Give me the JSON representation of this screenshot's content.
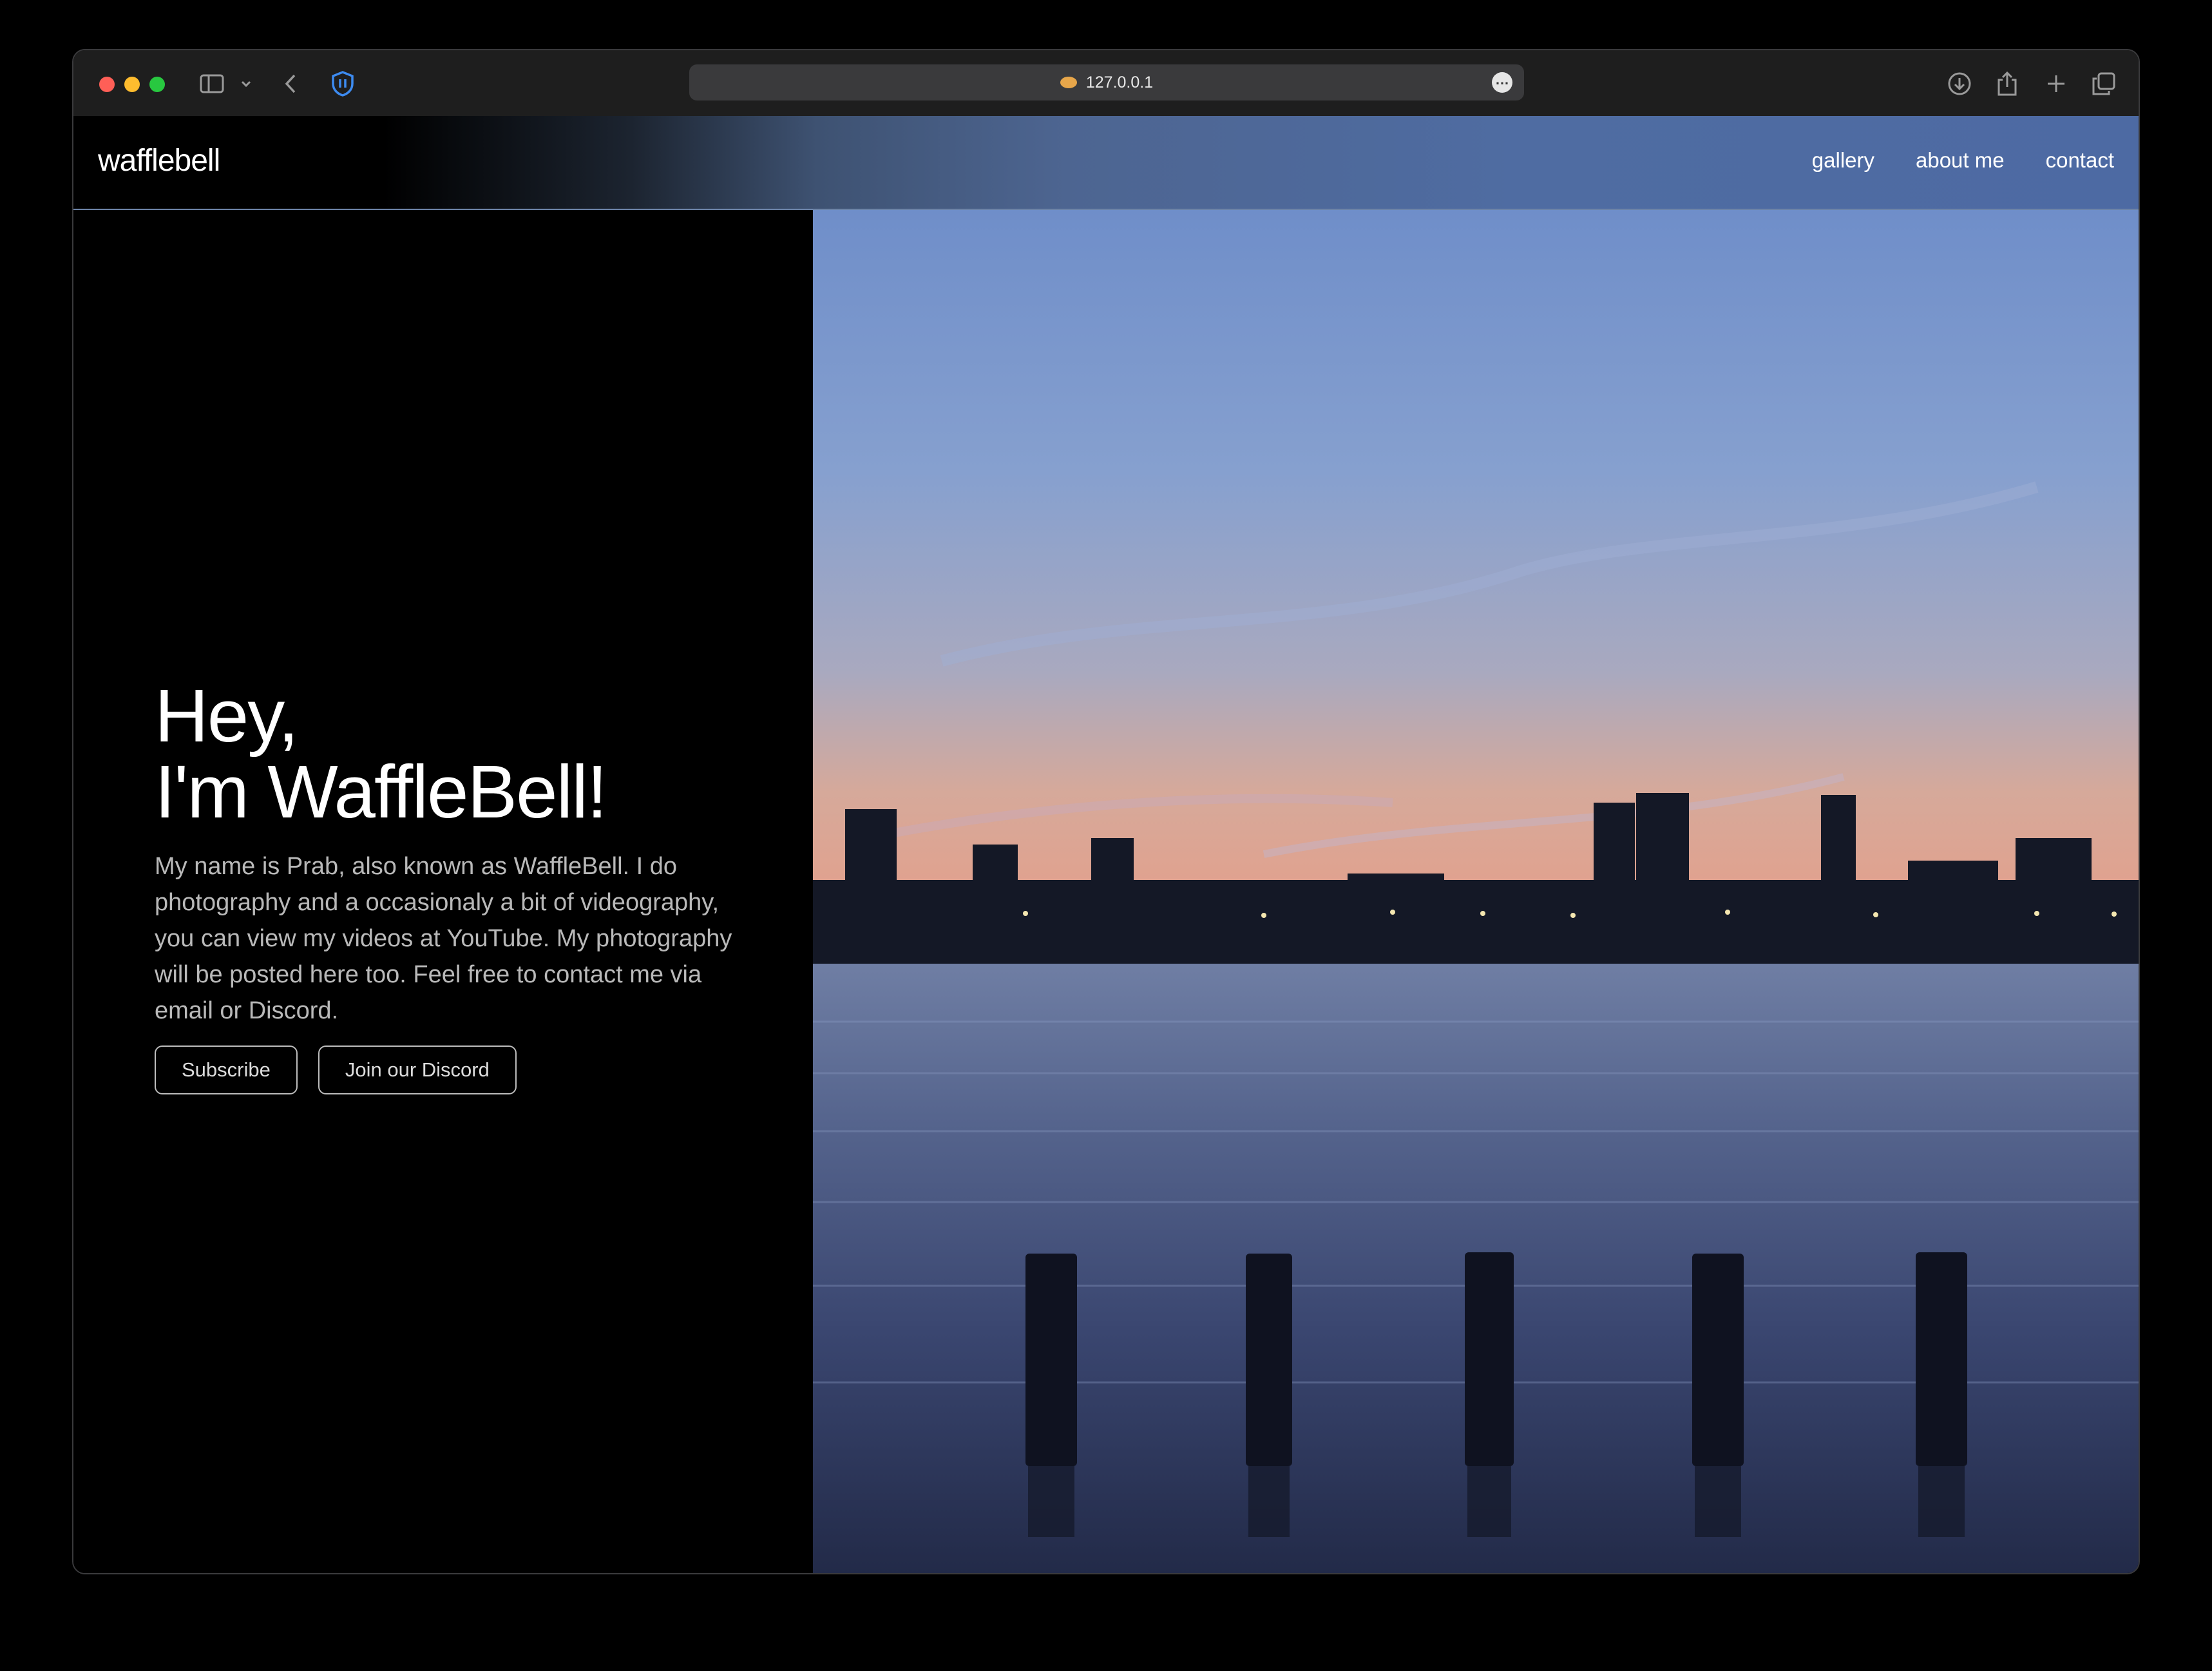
{
  "browser": {
    "url": "127.0.0.1"
  },
  "site": {
    "brand": "wafflebell",
    "nav": [
      "gallery",
      "about me",
      "contact"
    ]
  },
  "hero": {
    "greeting": "Hey,",
    "headline": "I'm WaffleBell!",
    "bio": "My name is Prab, also known as WaffleBell. I do photography and a occasionaly a bit of videography, you can view my videos at YouTube. My photography will be posted here too. Feel free to contact me via email or Discord.",
    "buttons": {
      "subscribe": "Subscribe",
      "discord": "Join our Discord"
    }
  },
  "colors": {
    "header_gradient_end": "#4d6aa3",
    "page_background": "#000000",
    "button_border": "#bdbdbd"
  },
  "icons": [
    "sidebar-icon",
    "chevron-down-icon",
    "back-icon",
    "shield-icon",
    "download-icon",
    "share-icon",
    "plus-icon",
    "tabs-icon",
    "more-icon"
  ]
}
